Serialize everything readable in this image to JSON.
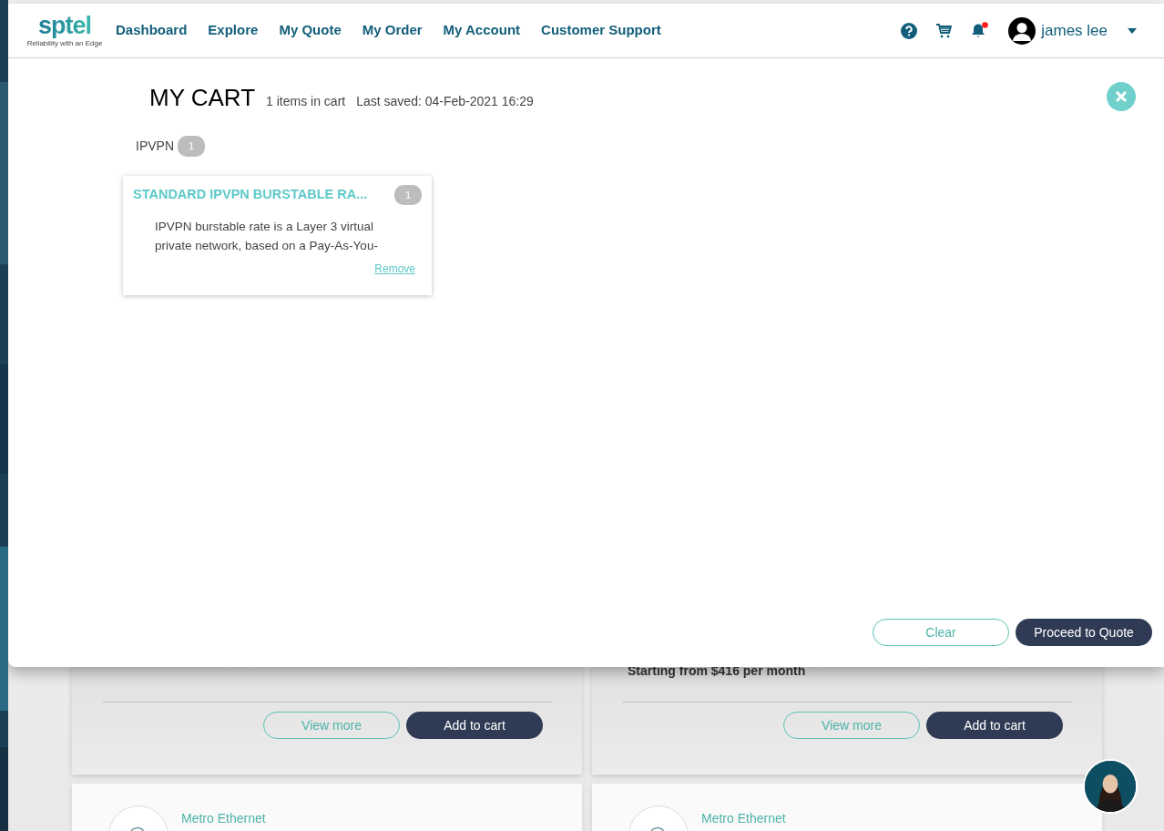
{
  "logo": {
    "text": "sptel",
    "tagline": "Reliability with an Edge"
  },
  "nav": [
    {
      "label": "Dashboard"
    },
    {
      "label": "Explore"
    },
    {
      "label": "My Quote"
    },
    {
      "label": "My Order"
    },
    {
      "label": "My Account"
    },
    {
      "label": "Customer Support"
    }
  ],
  "user": {
    "name": "james lee",
    "has_notification": true
  },
  "cart": {
    "title": "MY CART",
    "count_text": "1 items in cart",
    "saved_text": "Last saved: 04-Feb-2021 16:29",
    "groups": [
      {
        "name": "IPVPN",
        "count": "1",
        "items": [
          {
            "title": "STANDARD IPVPN BURSTABLE RA...",
            "quantity": "1",
            "description": "IPVPN burstable rate is a Layer 3 virtual private network, based on a Pay-As-You-",
            "remove_label": "Remove"
          }
        ]
      }
    ],
    "buttons": [
      {
        "label": "Clear",
        "kind": "outline"
      },
      {
        "label": "Proceed to Quote",
        "kind": "primary"
      }
    ]
  },
  "products": [
    {
      "view_label": "View more",
      "add_label": "Add to cart"
    },
    {
      "price": "Starting from $416 per month",
      "view_label": "View more",
      "add_label": "Add to cart"
    }
  ],
  "next_products": [
    {
      "category": "Metro Ethernet"
    },
    {
      "category": "Metro Ethernet"
    }
  ]
}
